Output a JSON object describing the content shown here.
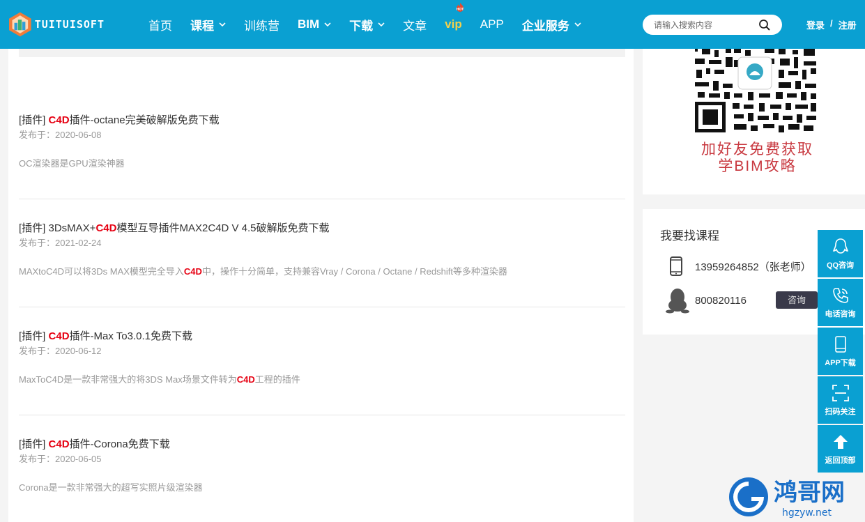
{
  "header": {
    "logo_text": "TUITUISOFT",
    "nav": [
      {
        "label": "首页"
      },
      {
        "label": "课程"
      },
      {
        "label": "训练营"
      },
      {
        "label": "BIM"
      },
      {
        "label": "下载"
      },
      {
        "label": "文章"
      },
      {
        "label": "vip",
        "badge": "HOT"
      },
      {
        "label": "APP"
      },
      {
        "label": "企业服务"
      }
    ],
    "search_placeholder": "请输入搜索内容",
    "login": "登录",
    "separator": "/",
    "register": "注册"
  },
  "articles": [
    {
      "prefix": "[插件] ",
      "keyword": "C4D",
      "title_rest": "插件-octane完美破解版免费下载",
      "date": "发布于：2020-06-08",
      "desc_before": "OC渲染器是GPU渲染神器",
      "desc_kw": "",
      "desc_after": ""
    },
    {
      "prefix": "[插件] 3DsMAX+",
      "keyword": "C4D",
      "title_rest": "模型互导插件MAX2C4D V 4.5破解版免费下载",
      "date": "发布于：2021-02-24",
      "desc_before": "MAXtoC4D可以将3Ds MAX模型完全导入",
      "desc_kw": "C4D",
      "desc_after": "中，操作十分简单，支持兼容Vray / Corona / Octane / Redshift等多种渲染器"
    },
    {
      "prefix": "[插件] ",
      "keyword": "C4D",
      "title_rest": "插件-Max To3.0.1免费下载",
      "date": "发布于：2020-06-12",
      "desc_before": "MaxToC4D是一款非常强大的将3DS Max场景文件转为",
      "desc_kw": "C4D",
      "desc_after": "工程的插件"
    },
    {
      "prefix": "[插件] ",
      "keyword": "C4D",
      "title_rest": "插件-Corona免费下载",
      "date": "发布于：2020-06-05",
      "desc_before": "Corona是一款非常强大的超写实照片级渲染器",
      "desc_kw": "",
      "desc_after": ""
    }
  ],
  "sidebar": {
    "qr_line1": "加好友免费获取",
    "qr_line2": "学BIM攻略",
    "course_title": "我要找课程",
    "phone": "13959264852（张老师）",
    "qq": "800820116",
    "consult": "咨询"
  },
  "float_bar": [
    {
      "label": "QQ咨询",
      "icon": "qq-icon"
    },
    {
      "label": "电话咨询",
      "icon": "phone-icon"
    },
    {
      "label": "APP下载",
      "icon": "mobile-icon"
    },
    {
      "label": "扫码关注",
      "icon": "scan-icon"
    },
    {
      "label": "返回顶部",
      "icon": "arrow-up-icon"
    }
  ],
  "watermark": {
    "brand": "鸿哥网",
    "domain": "hgzyw.net"
  },
  "colors": {
    "primary": "#0aa0d2",
    "keyword": "#e60012",
    "vip": "#f5d04b",
    "qr_text": "#c8383f"
  }
}
